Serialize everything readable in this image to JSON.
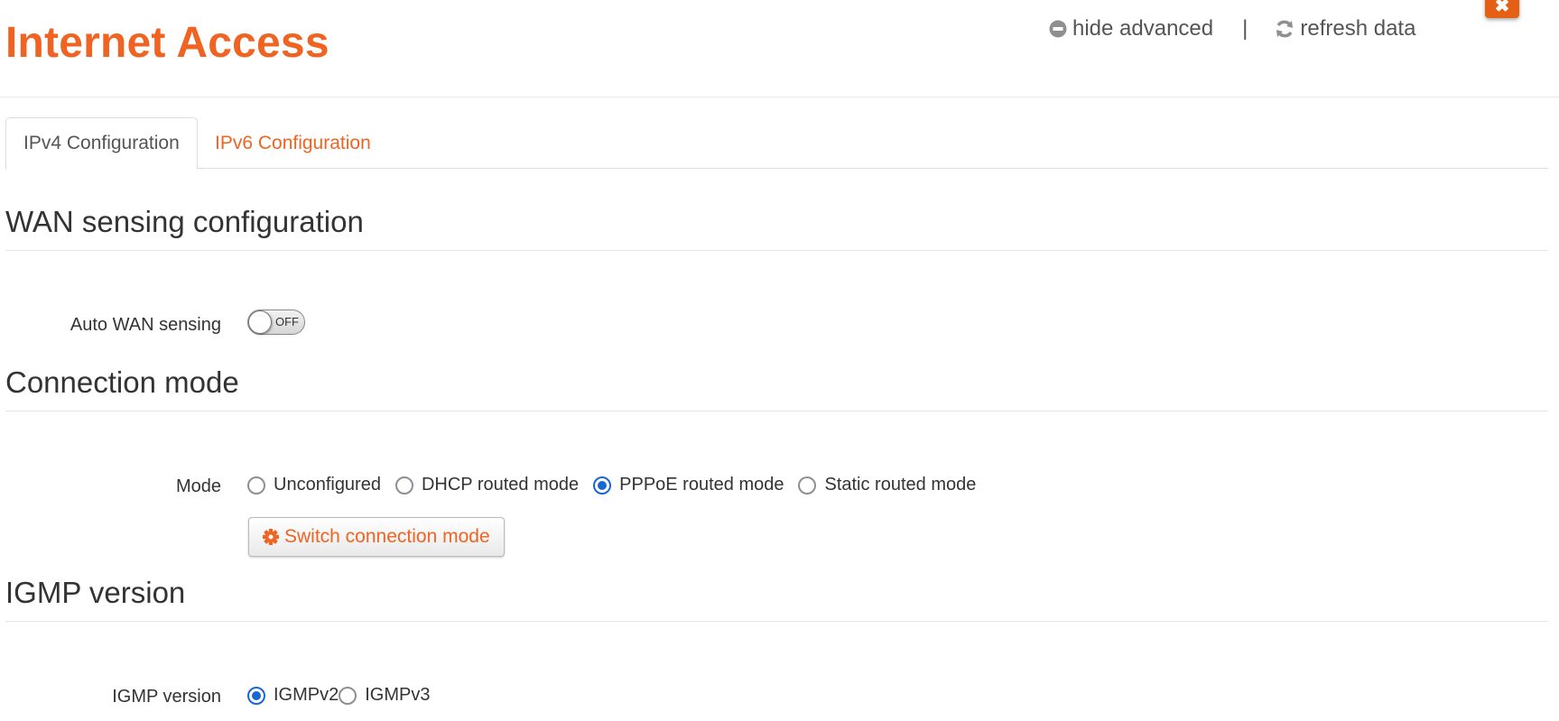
{
  "header": {
    "title": "Internet Access",
    "hide_advanced_label": "hide advanced",
    "separator": "|",
    "refresh_label": "refresh data",
    "close_label": "✖",
    "accent_color": "#ef6423"
  },
  "tabs": [
    {
      "label": "IPv4 Configuration",
      "active": true
    },
    {
      "label": "IPv6 Configuration",
      "active": false
    }
  ],
  "sections": {
    "wan": {
      "heading": "WAN sensing configuration",
      "auto_wan_label": "Auto WAN sensing",
      "auto_wan_toggle_text": "OFF",
      "auto_wan_enabled": false
    },
    "connection": {
      "heading": "Connection mode",
      "mode_label": "Mode",
      "options": [
        {
          "label": "Unconfigured",
          "checked": false
        },
        {
          "label": "DHCP routed mode",
          "checked": false
        },
        {
          "label": "PPPoE routed mode",
          "checked": true
        },
        {
          "label": "Static routed mode",
          "checked": false
        }
      ],
      "switch_button_label": "Switch connection mode"
    },
    "igmp": {
      "heading": "IGMP version",
      "label": "IGMP version",
      "options": [
        {
          "label": "IGMPv2",
          "checked": true
        },
        {
          "label": "IGMPv3",
          "checked": false
        }
      ]
    }
  }
}
